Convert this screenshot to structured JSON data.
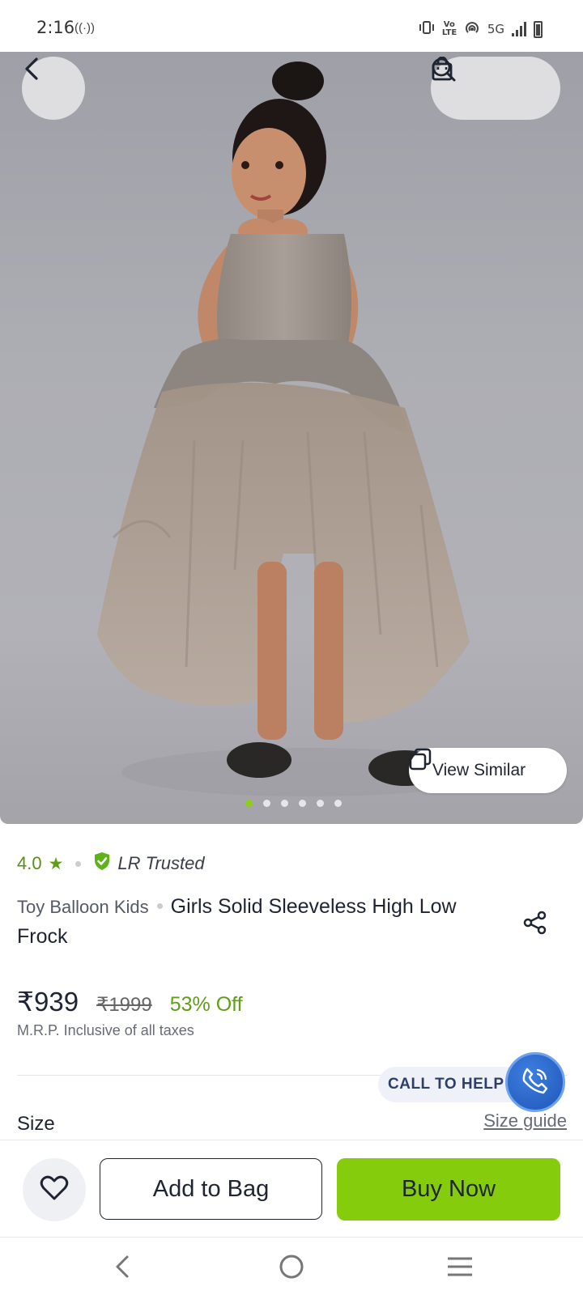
{
  "status_bar": {
    "time": "2:16",
    "cast_glyph": "((·))",
    "network": "5G",
    "volte": "Vo LTE",
    "icons": [
      "vibrate-icon",
      "volte-icon",
      "hotspot-icon",
      "signal-icon",
      "battery-icon"
    ]
  },
  "hero": {
    "view_similar_label": "View Similar",
    "image_count": 6,
    "active_image_index": 0,
    "icons": [
      "back-arrow-icon",
      "search-icon",
      "bag-icon",
      "copy-icon"
    ]
  },
  "product": {
    "rating": "4.0",
    "rating_icon": "star-icon",
    "trusted_label": "LR Trusted",
    "brand": "Toy Balloon Kids",
    "name": "Girls Solid Sleeveless High Low Frock",
    "price": "₹939",
    "mrp": "₹1999",
    "discount": "53% Off",
    "tax_note": "M.R.P. Inclusive of all taxes",
    "share_icon": "share-icon"
  },
  "help": {
    "call_label": "CALL TO HELP",
    "icon": "phone-icon"
  },
  "size": {
    "label": "Size",
    "guide_link": "Size guide"
  },
  "actions": {
    "wishlist_icon": "heart-icon",
    "add_to_bag": "Add to Bag",
    "buy_now": "Buy Now"
  },
  "nav": {
    "icons": [
      "nav-back-icon",
      "nav-home-icon",
      "nav-menu-icon"
    ]
  },
  "colors": {
    "accent_green": "#84cc0c",
    "rating_green": "#5f9e16",
    "call_blue": "#1f56b8",
    "text_dark": "#1f2433"
  }
}
